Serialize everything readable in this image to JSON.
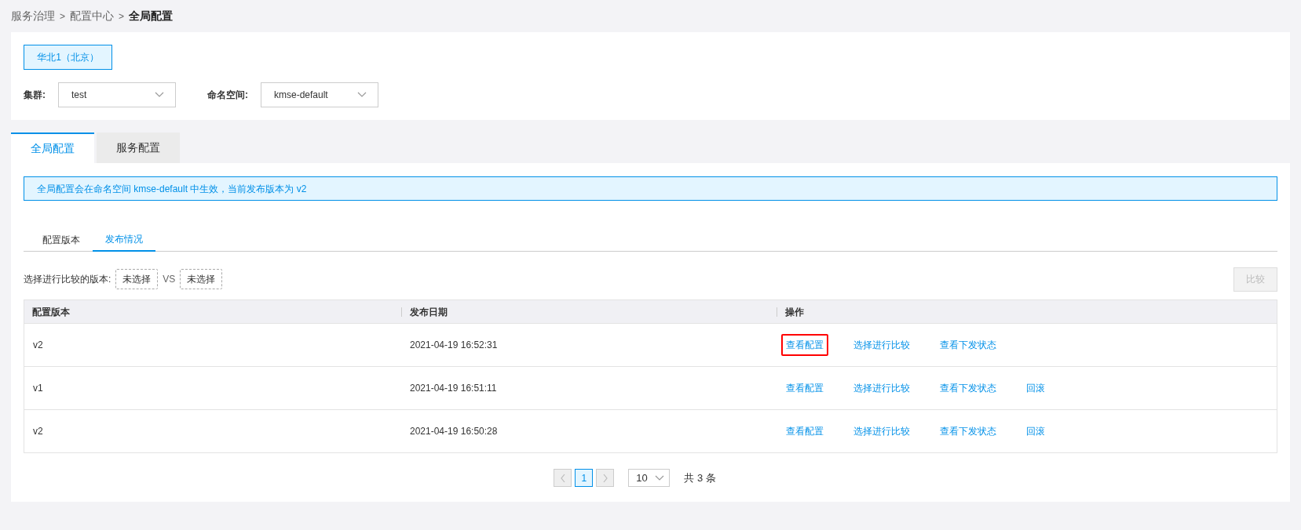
{
  "breadcrumb": [
    {
      "kind": "link",
      "text": "服务治理"
    },
    {
      "kind": "separator",
      "text": ">"
    },
    {
      "kind": "link",
      "text": "配置中心"
    },
    {
      "kind": "separator",
      "text": ">"
    },
    {
      "kind": "current",
      "text": "全局配置"
    }
  ],
  "regions": [
    {
      "label": "华北1（北京）",
      "selected": true
    }
  ],
  "filters": [
    {
      "label": "集群:",
      "value": "test"
    },
    {
      "label": "命名空间:",
      "value": "kmse-default"
    }
  ],
  "tabs": [
    {
      "label": "全局配置",
      "selected": true
    },
    {
      "label": "服务配置",
      "selected": false
    }
  ],
  "alert": "全局配置会在命名空间 kmse-default 中生效，当前发布版本为 v2",
  "subtabs": [
    {
      "label": "配置版本",
      "selected": false
    },
    {
      "label": "发布情况",
      "selected": true
    }
  ],
  "compare": {
    "label": "选择进行比较的版本:",
    "left": "未选择",
    "vs": "VS",
    "right": "未选择",
    "button": {
      "label": "比较",
      "disabled": true
    }
  },
  "table": {
    "columns": [
      "配置版本",
      "发布日期",
      "操作"
    ],
    "rows": [
      {
        "version": "v2",
        "date": "2021-04-19 16:52:31",
        "actions": [
          {
            "label": "查看配置",
            "highlighted": true
          },
          {
            "label": "选择进行比较",
            "highlighted": false
          },
          {
            "label": "查看下发状态",
            "highlighted": false
          }
        ]
      },
      {
        "version": "v1",
        "date": "2021-04-19 16:51:11",
        "actions": [
          {
            "label": "查看配置",
            "highlighted": false
          },
          {
            "label": "选择进行比较",
            "highlighted": false
          },
          {
            "label": "查看下发状态",
            "highlighted": false
          },
          {
            "label": "回滚",
            "highlighted": false
          }
        ]
      },
      {
        "version": "v2",
        "date": "2021-04-19 16:50:28",
        "actions": [
          {
            "label": "查看配置",
            "highlighted": false
          },
          {
            "label": "选择进行比较",
            "highlighted": false
          },
          {
            "label": "查看下发状态",
            "highlighted": false
          },
          {
            "label": "回滚",
            "highlighted": false
          }
        ]
      }
    ]
  },
  "pagination": {
    "pages": [
      {
        "label": "1",
        "selected": true
      }
    ],
    "prev_disabled": true,
    "next_disabled": true,
    "page_size": "10",
    "total": "共 3 条"
  }
}
